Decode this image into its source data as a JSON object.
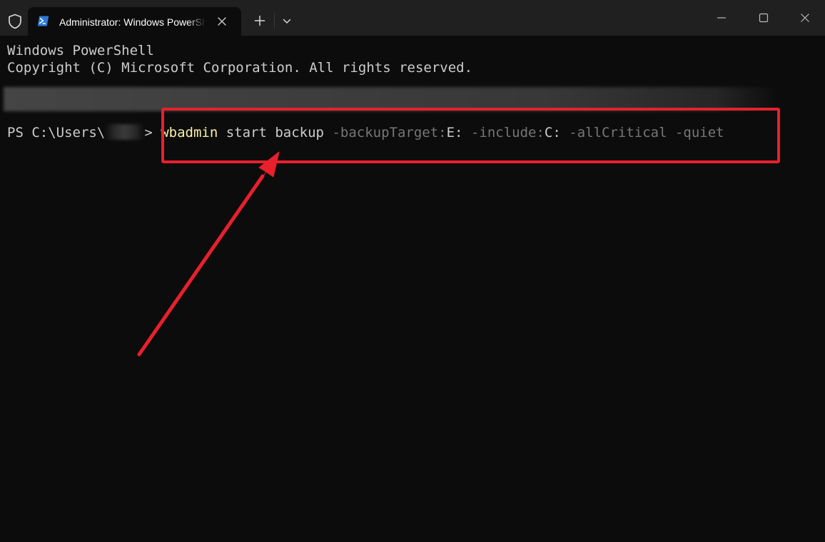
{
  "window": {
    "tab_title": "Administrator: Windows PowerShell",
    "icons": {
      "shield": "shield-icon",
      "app": "powershell-icon",
      "tab_close": "close-icon",
      "new_tab": "plus-icon",
      "dropdown": "chevron-down-icon",
      "minimize": "minimize-icon",
      "maximize": "maximize-icon",
      "close": "close-icon"
    }
  },
  "terminal": {
    "lines": [
      "Windows PowerShell",
      "Copyright (C) Microsoft Corporation. All rights reserved."
    ],
    "prompt_prefix": "PS C:\\Users\\",
    "prompt_suffix": ">",
    "command": {
      "name": "wbadmin",
      "args": "start backup",
      "p1_name": "-backupTarget:",
      "p1_value": "E:",
      "p2_name": "-include:",
      "p2_value": "C:",
      "p3_name": "-allCritical",
      "p4_name": "-quiet"
    }
  },
  "colors": {
    "background": "#0c0c0c",
    "titlebar": "#202020",
    "text": "#cccccc",
    "command": "#f9f1a5",
    "parameter": "#767676",
    "annotation": "#e8202c"
  }
}
